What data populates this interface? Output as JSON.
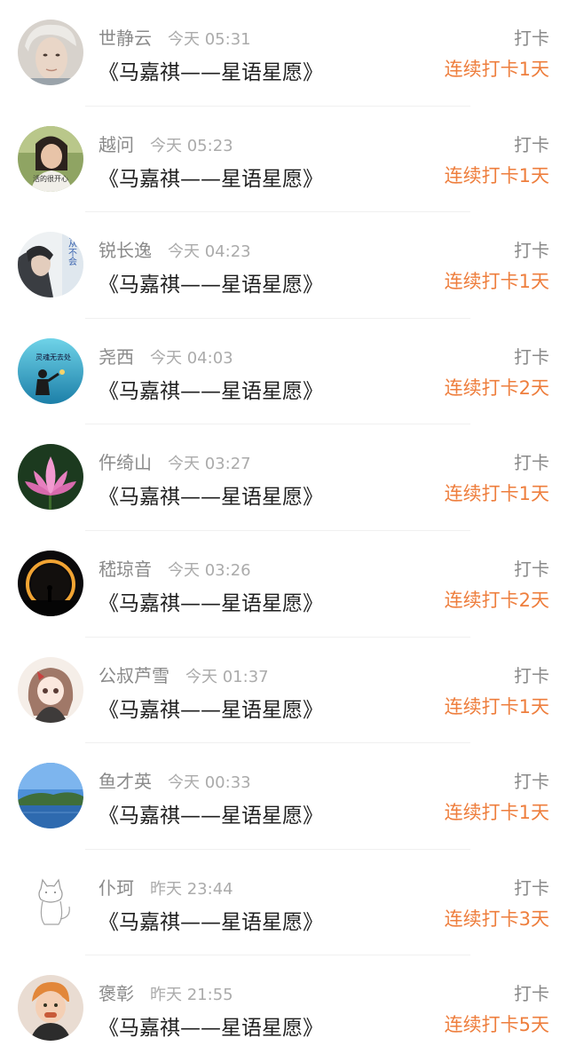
{
  "colors": {
    "accent": "#ee7e3d",
    "name": "#8a8a8a",
    "title": "#1f1f1f"
  },
  "entries": [
    {
      "name": "世静云",
      "time": "今天 05:31",
      "title": "《马嘉祺——星语星愿》",
      "action": "打卡",
      "streak": "连续打卡1天",
      "avatar_icon": "avatar-portrait"
    },
    {
      "name": "越问",
      "time": "今天 05:23",
      "title": "《马嘉祺——星语星愿》",
      "action": "打卡",
      "streak": "连续打卡1天",
      "avatar_icon": "avatar-girl-photo",
      "avatar_caption": "活的很开心"
    },
    {
      "name": "锐长逸",
      "time": "今天 04:23",
      "title": "《马嘉祺——星语星愿》",
      "action": "打卡",
      "streak": "连续打卡1天",
      "avatar_icon": "avatar-text-portrait",
      "avatar_caption": "我从不会"
    },
    {
      "name": "尧西",
      "time": "今天 04:03",
      "title": "《马嘉祺——星语星愿》",
      "action": "打卡",
      "streak": "连续打卡2天",
      "avatar_icon": "avatar-sky-figure",
      "avatar_caption": "灵魂无去处"
    },
    {
      "name": "仵绮山",
      "time": "今天 03:27",
      "title": "《马嘉祺——星语星愿》",
      "action": "打卡",
      "streak": "连续打卡1天",
      "avatar_icon": "avatar-lotus"
    },
    {
      "name": "嵇琼音",
      "time": "今天 03:26",
      "title": "《马嘉祺——星语星愿》",
      "action": "打卡",
      "streak": "连续打卡2天",
      "avatar_icon": "avatar-eclipse"
    },
    {
      "name": "公叔芦雪",
      "time": "今天 01:37",
      "title": "《马嘉祺——星语星愿》",
      "action": "打卡",
      "streak": "连续打卡1天",
      "avatar_icon": "avatar-anime-girl"
    },
    {
      "name": "鱼才英",
      "time": "今天 00:33",
      "title": "《马嘉祺——星语星愿》",
      "action": "打卡",
      "streak": "连续打卡1天",
      "avatar_icon": "avatar-landscape"
    },
    {
      "name": "仆珂",
      "time": "昨天 23:44",
      "title": "《马嘉祺——星语星愿》",
      "action": "打卡",
      "streak": "连续打卡3天",
      "avatar_icon": "avatar-cat-sketch"
    },
    {
      "name": "褒彰",
      "time": "昨天 21:55",
      "title": "《马嘉祺——星语星愿》",
      "action": "打卡",
      "streak": "连续打卡5天",
      "avatar_icon": "avatar-child"
    }
  ]
}
